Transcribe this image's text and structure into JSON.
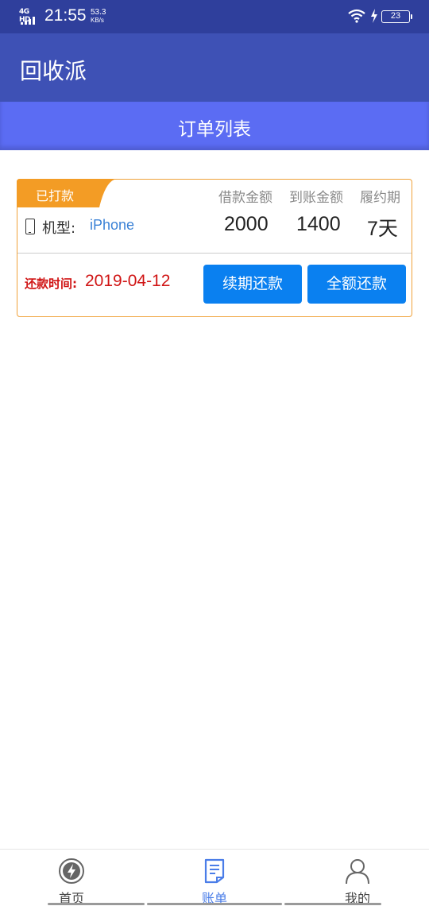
{
  "status_bar": {
    "network": "4G HD",
    "time": "21:55",
    "speed_value": "53.3",
    "speed_unit": "KB/s",
    "battery": "23"
  },
  "app_bar": {
    "title": "回收派"
  },
  "sub_header": {
    "title": "订单列表"
  },
  "order": {
    "status": "已打款",
    "columns": [
      {
        "header": "借款金额",
        "value": "2000"
      },
      {
        "header": "到账金额",
        "value": "1400"
      },
      {
        "header": "履约期",
        "value": "7天"
      }
    ],
    "model_label": "机型:",
    "model_value": "iPhone",
    "due_label": "还款时间:",
    "due_value": "2019-04-12",
    "renew_button": "续期还款",
    "full_button": "全额还款"
  },
  "bottom_nav": {
    "items": [
      {
        "label": "首页",
        "icon": "home-bolt-icon"
      },
      {
        "label": "账单",
        "icon": "bill-document-icon",
        "active": true
      },
      {
        "label": "我的",
        "icon": "user-profile-icon"
      }
    ]
  },
  "colors": {
    "status_bar": "#2f3f9c",
    "app_bar": "#3e51b5",
    "sub_header": "#5b6cf3",
    "card_border": "#f0a23a",
    "primary_button": "#0a80f0",
    "due_text": "#d01414",
    "active_nav": "#4a7de8"
  }
}
